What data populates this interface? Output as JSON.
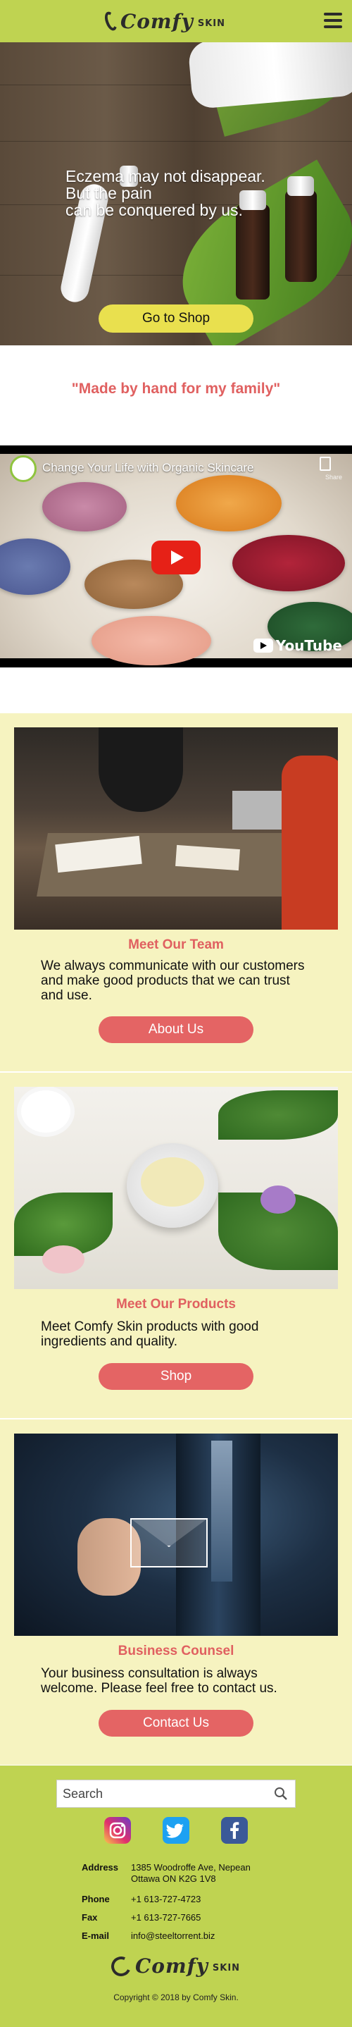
{
  "header": {
    "logo_word": "Comfy",
    "logo_sub": "SKIN"
  },
  "hero": {
    "headline_line1": "Eczema may not disappear.",
    "headline_line2": "But the pain",
    "headline_line3": "can be conquered by us.",
    "button_label": "Go to Shop"
  },
  "quote": "\"Made by hand for my family\"",
  "video": {
    "title": "Change Your Life with Organic Skincare",
    "share_label": "Share",
    "brand": "YouTube"
  },
  "cards": [
    {
      "title": "Meet Our Team",
      "text": "We always communicate with our customers and make good products that we can trust and use.",
      "button_label": "About Us"
    },
    {
      "title": "Meet Our Products",
      "text": "Meet Comfy Skin products with good ingredients and quality.",
      "button_label": "Shop"
    },
    {
      "title": "Business Counsel",
      "text": "Your business consultation is always welcome. Please feel free to contact us.",
      "button_label": "Contact Us"
    }
  ],
  "footer": {
    "search_placeholder": "Search",
    "social": [
      "instagram-icon",
      "twitter-icon",
      "facebook-icon"
    ],
    "contact": {
      "address_label": "Address",
      "address_line1": "1385 Woodroffe Ave, Nepean",
      "address_line2": "Ottawa ON K2G 1V8",
      "phone_label": "Phone",
      "phone": "+1 613-727-4723",
      "fax_label": "Fax",
      "fax": "+1 613-727-7665",
      "email_label": "E-mail",
      "email": "info@steeltorrent.biz"
    },
    "logo_word": "Comfy",
    "logo_sub": "SKIN",
    "copyright": "Copyright © 2018 by Comfy Skin."
  },
  "colors": {
    "header_green": "#bfd351",
    "accent_red": "#e06060",
    "button_red": "#e46464",
    "hero_button_yellow": "#e9e04e",
    "card_bg": "#f6f3c0"
  }
}
